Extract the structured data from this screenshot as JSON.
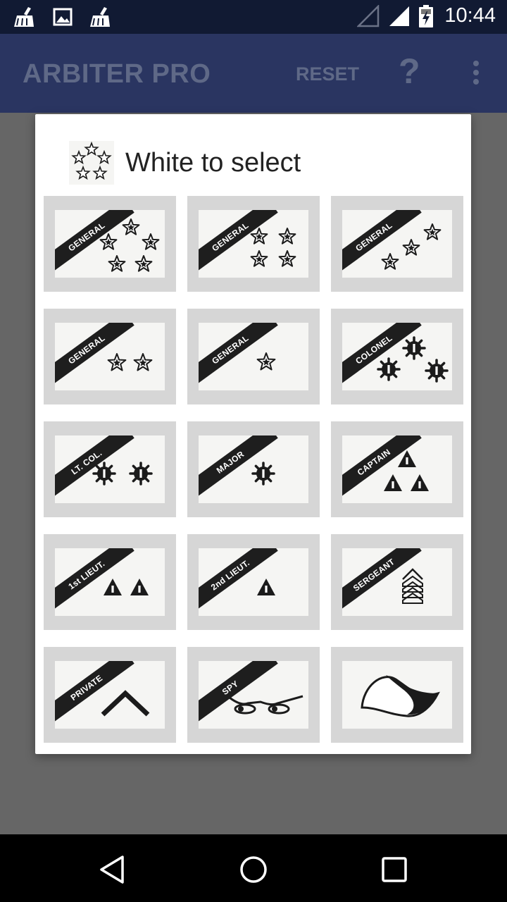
{
  "status_bar": {
    "time": "10:44",
    "left_icons": [
      "cleaner-icon",
      "image-icon",
      "cleaner-icon"
    ],
    "right_icons": [
      "no-signal-icon",
      "signal-icon",
      "battery-charging-icon"
    ]
  },
  "app_bar": {
    "title": "ARBITER PRO",
    "reset_label": "RESET",
    "help_label": "?"
  },
  "dialog": {
    "title": "White to select",
    "pieces": [
      {
        "sash": "GENERAL",
        "symbol": "5-star"
      },
      {
        "sash": "GENERAL",
        "symbol": "4-star"
      },
      {
        "sash": "GENERAL",
        "symbol": "3-star"
      },
      {
        "sash": "GENERAL",
        "symbol": "2-star"
      },
      {
        "sash": "GENERAL",
        "symbol": "1-star"
      },
      {
        "sash": "COLONEL",
        "symbol": "3-sun"
      },
      {
        "sash": "LT. COL.",
        "symbol": "2-sun"
      },
      {
        "sash": "MAJOR",
        "symbol": "1-sun"
      },
      {
        "sash": "CAPTAIN",
        "symbol": "3-triangle"
      },
      {
        "sash": "1st LIEUT.",
        "symbol": "2-triangle"
      },
      {
        "sash": "2nd LIEUT.",
        "symbol": "1-triangle"
      },
      {
        "sash": "SERGEANT",
        "symbol": "chevrons"
      },
      {
        "sash": "PRIVATE",
        "symbol": "chevron"
      },
      {
        "sash": "SPY",
        "symbol": "eyes"
      },
      {
        "sash": "",
        "symbol": "flag"
      }
    ]
  },
  "nav_bar": {
    "buttons": [
      "back-icon",
      "home-icon",
      "recents-icon"
    ]
  },
  "colors": {
    "status_bar": "#111a33",
    "app_bar": "#2a3561",
    "app_bar_text": "#5f6987",
    "scrim": "#666666",
    "tile": "#d6d6d6"
  }
}
